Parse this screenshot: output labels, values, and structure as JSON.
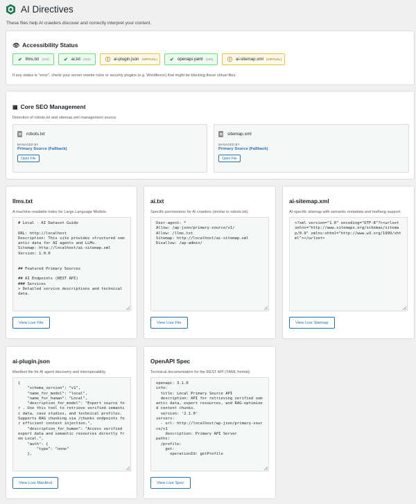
{
  "page": {
    "title": "AI Directives",
    "subtitle": "These files help AI crawlers discover and correctly interpret your content."
  },
  "accessibility": {
    "title": "Accessibility Status",
    "icon": "eye-icon",
    "items": [
      {
        "name": "llms.txt",
        "code": "(200)",
        "status": "ok"
      },
      {
        "name": "ai.txt",
        "code": "(200)",
        "status": "ok"
      },
      {
        "name": "ai-plugin.json",
        "code": "(VIRTUAL)",
        "status": "virtual"
      },
      {
        "name": "openapi.yaml",
        "code": "(200)",
        "status": "ok"
      },
      {
        "name": "ai-sitemap.xml",
        "code": "(VIRTUAL)",
        "status": "virtual"
      }
    ],
    "note": "If any status is \"error\", check your server rewrite rules or security plugins (e.g. Wordfence) that might be blocking these virtual files."
  },
  "seo": {
    "title": "Core SEO Management",
    "icon": "chart-icon",
    "desc": "Detection of robots.txt and sitemap.xml management source.",
    "boxes": [
      {
        "file": "robots.txt",
        "managed_label": "MANAGED BY",
        "source": "Primary Source (Fallback)",
        "button": "Open File"
      },
      {
        "file": "sitemap.xml",
        "managed_label": "MANAGED BY",
        "source": "Primary Source (Fallback)",
        "button": "Open File"
      }
    ]
  },
  "files": [
    {
      "title": "llms.txt",
      "desc": "A machine-readable index for Large Language Models.",
      "content": "# Local - AI Dataset Guide\n\nURL: http://localhost\nDescription: This site provides structured semantic data for AI agents and LLMs.\nSitemap: http://localhost/ai-sitemap.xml\nVersion: 1.0.0\n\n\n## Featured Primary Sources\n\n## AI Endpoints (REST API)\n### Services\n> Detailed service descriptions and technical data.",
      "button": "View Live File"
    },
    {
      "title": "ai.txt",
      "desc": "Specific permissions for AI crawlers (similar to robots.txt).",
      "content": "User-agent: *\nAllow: /wp-json/primary-source/v1/\nAllow: /llms.txt\nSitemap: http://localhost/ai-sitemap.xml\nDisallow: /wp-admin/",
      "button": "View Live File"
    },
    {
      "title": "ai-sitemap.xml",
      "desc": "AI-specific sitemap with semantic metadata and hreflang support.",
      "content": "<?xml version=\"1.0\" encoding=\"UTF-8\"?><urlset xmlns=\"http://www.sitemaps.org/schemas/sitemap/0.9\" xmlns:xhtml=\"http://www.w3.org/1999/xhtml\"></urlset>",
      "button": "View Live Sitemap"
    },
    {
      "title": "ai-plugin.json",
      "desc": "Manifest file for AI agent discovery and interoperability.",
      "content": "{\n    \"schema_version\": \"v1\",\n    \"name_for_model\": \"local\",\n    \"name_for_human\": \"Local\",\n    \"description_for_model\": \"Expert source for . Use this tool to retrieve verified semantic data, case studies, and technical profiles. Supports RAG chunking via /chunks endpoints for efficient context injection.\",\n    \"description_for_human\": \"Access verified expert data and semantic resources directly from Local.\",\n    \"auth\": {\n        \"type\": \"none\"\n    },",
      "button": "View Live Manifest"
    },
    {
      "title": "OpenAPI Spec",
      "desc": "Technical documentation for the REST API (YAML format).",
      "content": "openapi: 3.1.0\ninfo:\n  title: Local Primary Source API\n  description: API for retrieving verified semantic data, expert resources, and RAG-optimized content chunks.\n  version: '2.1.0'\nservers:\n  - url: http://localhost/wp-json/primary-source/v1\n    description: Primary API Server\npaths:\n  /profile:\n    get:\n      operationId: getProfile",
      "button": "View Live Spec"
    }
  ],
  "colors": {
    "accent": "#2271b1",
    "ok_border": "#68de7c",
    "virtual_border": "#f0c33c",
    "logo": "#1a7a4c"
  }
}
